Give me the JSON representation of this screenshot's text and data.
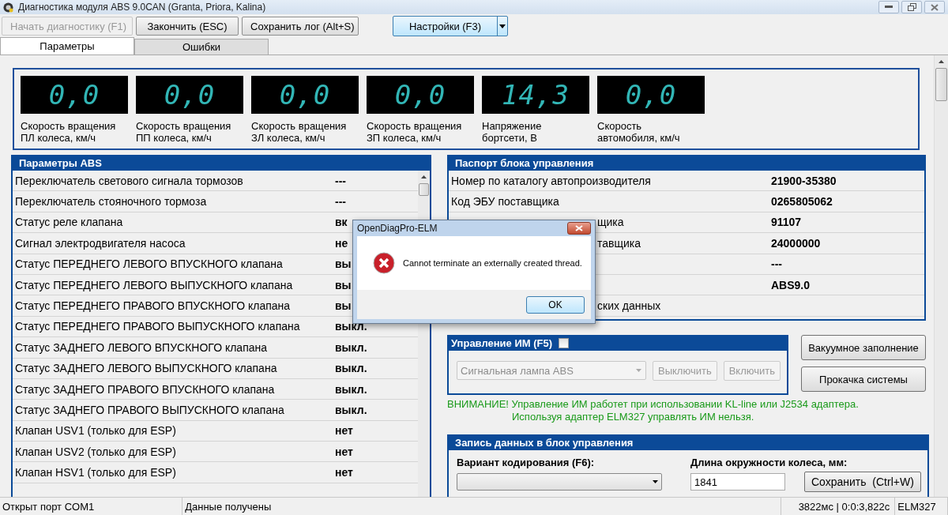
{
  "window": {
    "title": "Диагностика модуля ABS 9.0CAN (Granta, Priora, Kalina)"
  },
  "toolbar": [
    {
      "label": "Начать диагностику (F1)",
      "disabled": true
    },
    {
      "label": "Закончить (ESC)",
      "disabled": false
    },
    {
      "label": "Сохранить лог (Alt+S)",
      "disabled": false
    }
  ],
  "settings_button": {
    "label": "Настройки (F3)"
  },
  "tabs": [
    {
      "label": "Параметры",
      "selected": true
    },
    {
      "label": "Ошибки",
      "selected": false
    }
  ],
  "gauges": [
    {
      "value": "0,0",
      "lines": [
        "Скорость вращения",
        "ПЛ колеса, км/ч"
      ]
    },
    {
      "value": "0,0",
      "lines": [
        "Скорость вращения",
        "ПП колеса, км/ч"
      ]
    },
    {
      "value": "0,0",
      "lines": [
        "Скорость вращения",
        "ЗЛ колеса, км/ч"
      ]
    },
    {
      "value": "0,0",
      "lines": [
        "Скорость вращения",
        "ЗП колеса, км/ч"
      ]
    },
    {
      "value": "14,3",
      "lines": [
        "Напряжение",
        "бортсети, В"
      ]
    },
    {
      "value": "0,0",
      "lines": [
        "Скорость",
        "автомобиля, км/ч"
      ]
    }
  ],
  "abs_params": {
    "title": "Параметры ABS",
    "rows": [
      {
        "label": "Переключатель светового сигнала тормозов",
        "value": "---"
      },
      {
        "label": "Переключатель стояночного тормоза",
        "value": "---"
      },
      {
        "label": "Статус реле клапана",
        "value": "вк"
      },
      {
        "label": "Сигнал электродвигателя насоса",
        "value": "не"
      },
      {
        "label": "Статус ПЕРЕДНЕГО ЛЕВОГО ВПУСКНОГО клапана",
        "value": "вы"
      },
      {
        "label": "Статус ПЕРЕДНЕГО ЛЕВОГО ВЫПУСКНОГО клапана",
        "value": "вы"
      },
      {
        "label": "Статус ПЕРЕДНЕГО ПРАВОГО ВПУСКНОГО клапана",
        "value": "вы"
      },
      {
        "label": "Статус ПЕРЕДНЕГО ПРАВОГО ВЫПУСКНОГО клапана",
        "value": "выкл."
      },
      {
        "label": "Статус ЗАДНЕГО ЛЕВОГО ВПУСКНОГО клапана",
        "value": "выкл."
      },
      {
        "label": "Статус ЗАДНЕГО ЛЕВОГО ВЫПУСКНОГО клапана",
        "value": "выкл."
      },
      {
        "label": "Статус ЗАДНЕГО ПРАВОГО ВПУСКНОГО клапана",
        "value": "выкл."
      },
      {
        "label": "Статус ЗАДНЕГО ПРАВОГО ВЫПУСКНОГО клапана",
        "value": "выкл."
      },
      {
        "label": "Клапан USV1 (только для ESP)",
        "value": "нет"
      },
      {
        "label": "Клапан USV2 (только для ESP)",
        "value": "нет"
      },
      {
        "label": "Клапан HSV1 (только для ESP)",
        "value": "нет"
      }
    ]
  },
  "passport": {
    "title": "Паспорт блока управления",
    "rows": [
      {
        "label": "Номер по каталогу автопроизводителя",
        "value": "21900-35380",
        "covered": false
      },
      {
        "label": "Код ЭБУ поставщика",
        "value": "0265805062",
        "covered": false
      },
      {
        "label": "щика",
        "value": "91107",
        "covered": true
      },
      {
        "label": "тавщика",
        "value": "24000000",
        "covered": true
      },
      {
        "value": "---"
      },
      {
        "value": "ABS9.0"
      },
      {
        "label": "ских данных",
        "covered": true
      }
    ]
  },
  "actuators": {
    "title": "Управление ИМ (F5)",
    "checked": false,
    "select": "Сигнальная лампа ABS",
    "buttons": [
      {
        "label": "Выключить",
        "disabled": true
      },
      {
        "label": "Включить",
        "disabled": true
      }
    ]
  },
  "side_buttons": [
    "Вакуумное заполнение",
    "Прокачка системы"
  ],
  "warning": [
    "ВНИМАНИЕ! Управление ИМ работет при использовании KL-line или J2534 адаптера.",
    "Используя адаптер ELM327 управлять ИМ нельзя."
  ],
  "write_panel": {
    "title": "Запись данных в блок управления",
    "coding_label": "Вариант кодирования (F6):",
    "wheel_label": "Длина окружности колеса, мм:",
    "wheel_value": "1841",
    "save_button": "Сохранить  (Ctrl+W)"
  },
  "status_bar": [
    "Открыт порт COM1",
    "Данные получены",
    "3822мс | 0:0:3,822с",
    "ELM327"
  ],
  "dialog": {
    "title": "OpenDiagPro-ELM",
    "message": "Cannot terminate an externally created thread.",
    "button": "OK"
  }
}
